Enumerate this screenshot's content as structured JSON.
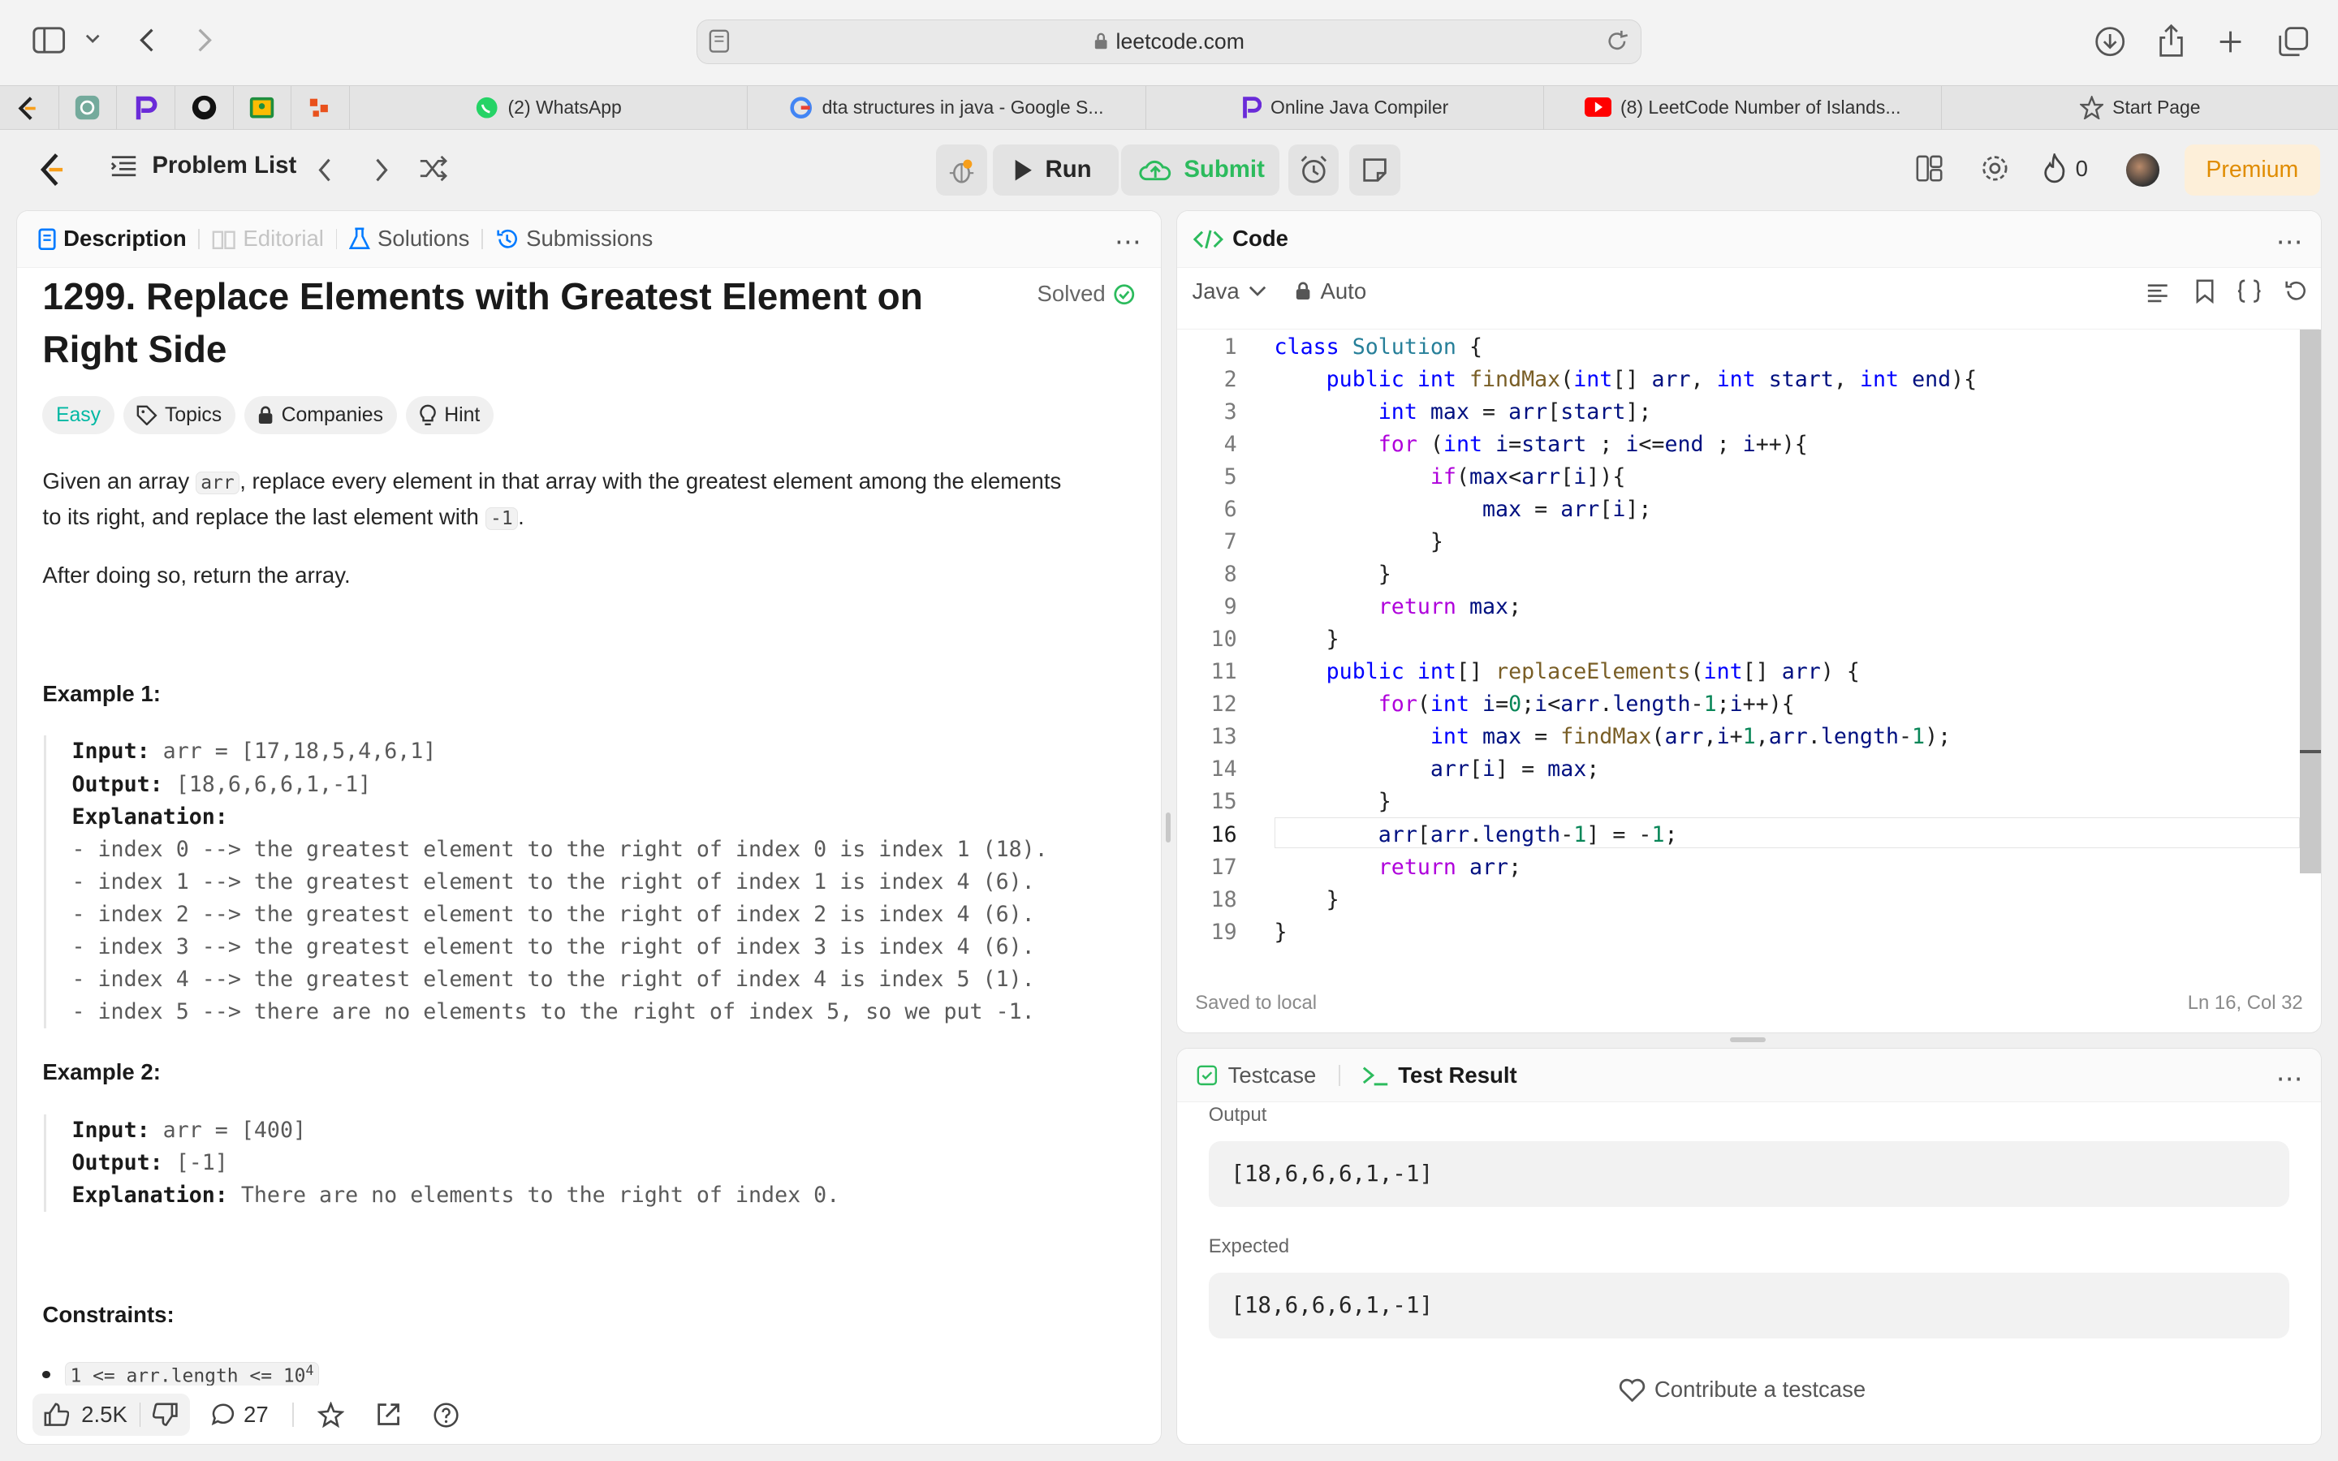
{
  "browser": {
    "url": "leetcode.com",
    "tabs": [
      {
        "label": "(2) WhatsApp",
        "icon": "whatsapp-icon"
      },
      {
        "label": "dta structures in java - Google S...",
        "icon": "google-icon"
      },
      {
        "label": "Online Java Compiler",
        "icon": "programiz-icon"
      },
      {
        "label": "(8) LeetCode Number of Islands...",
        "icon": "youtube-icon"
      },
      {
        "label": "Start Page",
        "icon": "star-icon"
      }
    ]
  },
  "nav": {
    "problem_list": "Problem List",
    "run": "Run",
    "submit": "Submit",
    "streak": "0",
    "premium": "Premium"
  },
  "left_tabs": {
    "description": "Description",
    "editorial": "Editorial",
    "solutions": "Solutions",
    "submissions": "Submissions"
  },
  "problem": {
    "title_line1": "1299. Replace Elements with Greatest Element on",
    "title_line2": "Right Side",
    "status": "Solved",
    "difficulty": "Easy",
    "chips": [
      "Topics",
      "Companies",
      "Hint"
    ],
    "desc_a": "Given an array ",
    "desc_code1": "arr",
    "desc_b": ", replace every element in that array with the greatest element among the elements",
    "desc_c": "to its right, and replace the last element with ",
    "desc_code2": "-1",
    "desc_d": ".",
    "desc2": "After doing so, return the array.",
    "ex1_title": "Example 1:",
    "ex1_input_label": "Input:",
    "ex1_input": " arr = [17,18,5,4,6,1]",
    "ex1_output_label": "Output:",
    "ex1_output": " [18,6,6,6,1,-1]",
    "ex1_expl_label": "Explanation:",
    "ex1_lines": [
      "- index 0 --> the greatest element to the right of index 0 is index 1 (18).",
      "- index 1 --> the greatest element to the right of index 1 is index 4 (6).",
      "- index 2 --> the greatest element to the right of index 2 is index 4 (6).",
      "- index 3 --> the greatest element to the right of index 3 is index 4 (6).",
      "- index 4 --> the greatest element to the right of index 4 is index 5 (1).",
      "- index 5 --> there are no elements to the right of index 5, so we put -1."
    ],
    "ex2_title": "Example 2:",
    "ex2_input_label": "Input:",
    "ex2_input": " arr = [400]",
    "ex2_output_label": "Output:",
    "ex2_output": " [-1]",
    "ex2_expl_label": "Explanation:",
    "ex2_expl": " There are no elements to the right of index 0.",
    "constraints_title": "Constraints:",
    "constraint1": "1 <= arr.length <= 10",
    "constraint1_sup": "4"
  },
  "footer": {
    "likes": "2.5K",
    "comments": "27"
  },
  "code_panel": {
    "title": "Code",
    "language": "Java",
    "mode": "Auto",
    "saved": "Saved to local",
    "cursor": "Ln 16, Col 32",
    "lines": [
      "1",
      "2",
      "3",
      "4",
      "5",
      "6",
      "7",
      "8",
      "9",
      "10",
      "11",
      "12",
      "13",
      "14",
      "15",
      "16",
      "17",
      "18",
      "19"
    ]
  },
  "test_panel": {
    "testcase": "Testcase",
    "result": "Test Result",
    "output_label": "Output",
    "output": "[18,6,6,6,1,-1]",
    "expected_label": "Expected",
    "expected": "[18,6,6,6,1,-1]",
    "contribute": "Contribute a testcase"
  },
  "colors": {
    "accent_green": "#2cbb5d",
    "easy": "#00b8a3",
    "premium_bg": "#fdefd9",
    "premium_text": "#e08c00"
  }
}
